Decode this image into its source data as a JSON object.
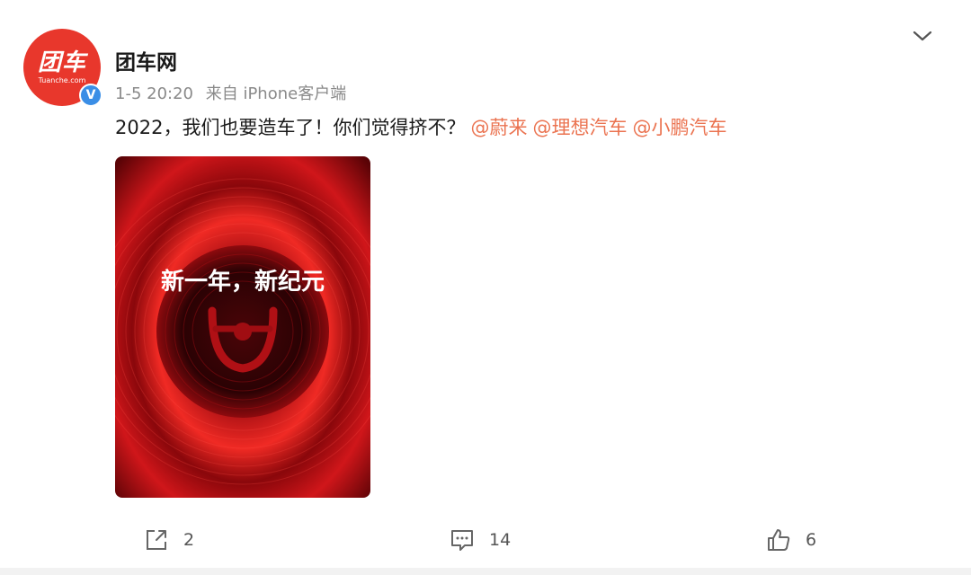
{
  "user": {
    "name": "团车网",
    "avatar_logo": "团车",
    "avatar_sub": "Tuanche.com",
    "verified_mark": "V"
  },
  "meta": {
    "time": "1-5 20:20",
    "source": "来自 iPhone客户端"
  },
  "post": {
    "text": "2022，我们也要造车了！你们觉得挤不？",
    "mentions": [
      "@蔚来",
      "@理想汽车",
      "@小鹏汽车"
    ],
    "image_caption": "新一年，新纪元"
  },
  "actions": {
    "share_count": "2",
    "comment_count": "14",
    "like_count": "6"
  },
  "colors": {
    "mention": "#eb7350",
    "brand_red": "#e8372c",
    "verified_blue": "#3a8ee6"
  },
  "icons": [
    "chevron-down-icon",
    "share-icon",
    "comment-icon",
    "like-icon",
    "steering-wheel-icon"
  ]
}
